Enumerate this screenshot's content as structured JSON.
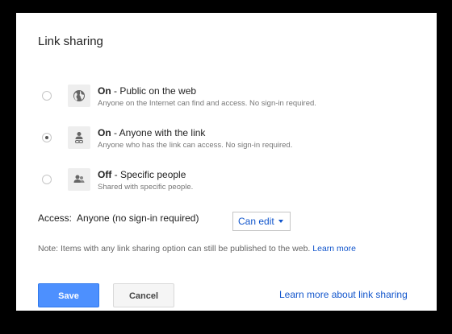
{
  "dialog": {
    "title": "Link sharing"
  },
  "options": [
    {
      "state": "On",
      "title_rest": " - Public on the web",
      "description": "Anyone on the Internet can find and access. No sign-in required.",
      "icon": "globe-icon",
      "selected": false
    },
    {
      "state": "On",
      "title_rest": " - Anyone with the link",
      "description": "Anyone who has the link can access. No sign-in required.",
      "icon": "person-link-icon",
      "selected": true
    },
    {
      "state": "Off",
      "title_rest": " - Specific people",
      "description": "Shared with specific people.",
      "icon": "people-icon",
      "selected": false
    }
  ],
  "access": {
    "label": "Access:",
    "value": "Anyone (no sign-in required)",
    "permission": "Can edit"
  },
  "note": {
    "text": "Note: Items with any link sharing option can still be published to the web.",
    "link": "Learn more"
  },
  "buttons": {
    "save": "Save",
    "cancel": "Cancel"
  },
  "footer_link": "Learn more about link sharing",
  "colors": {
    "primary_button": "#4d90fe",
    "link": "#1155cc"
  }
}
